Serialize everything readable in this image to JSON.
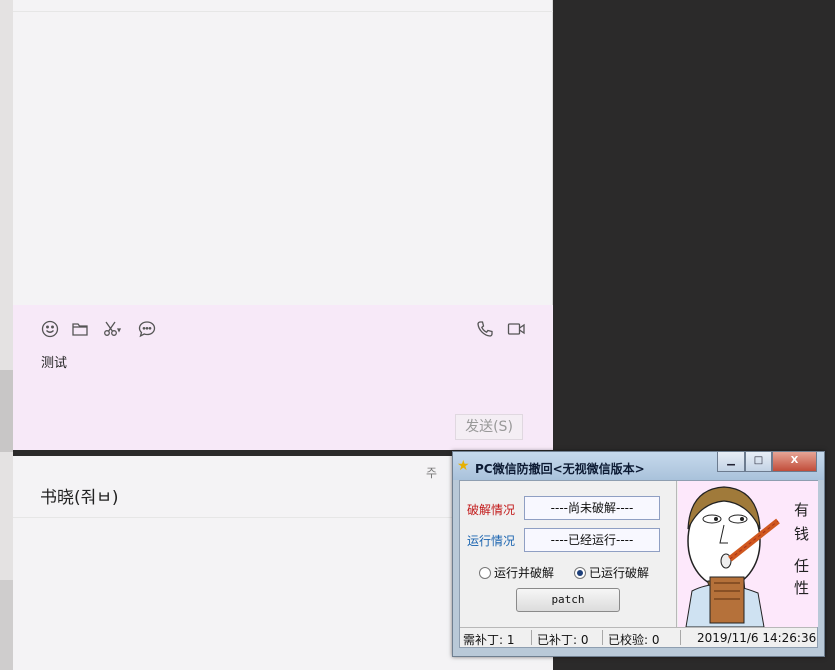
{
  "composer": {
    "message_text": "测试",
    "send_label": "发送(S)",
    "icons": [
      "emoji-icon",
      "folder-icon",
      "scissors-icon",
      "chat-bubble-icon",
      "phone-icon",
      "video-icon"
    ]
  },
  "conversation": {
    "contact_name": "书晓(줘ㅂ)",
    "pin_glyph": "주"
  },
  "patch_dialog": {
    "title": "PC微信防撤回<无视微信版本>",
    "rows": [
      {
        "label": "破解情况",
        "value": "----尚未破解----"
      },
      {
        "label": "运行情况",
        "value": "----已经运行----"
      }
    ],
    "radio_options": [
      {
        "label": "运行并破解",
        "selected": false
      },
      {
        "label": "已运行破解",
        "selected": true
      }
    ],
    "patch_button": "patch",
    "side_text": [
      "有",
      "钱",
      "任",
      "性"
    ],
    "status": {
      "need_patch": "需补丁: 1",
      "patched": "已补丁: 0",
      "verified": "已校验: 0",
      "datetime": "2019/11/6 14:26:36"
    },
    "window_buttons": {
      "minimize": "▁",
      "maximize": "□",
      "close": "X"
    }
  },
  "colors": {
    "composer_bg": "#f7e9f8",
    "label_red": "#c21818",
    "label_blue": "#1a64b0",
    "desktop_bg": "#2b2a2a"
  }
}
